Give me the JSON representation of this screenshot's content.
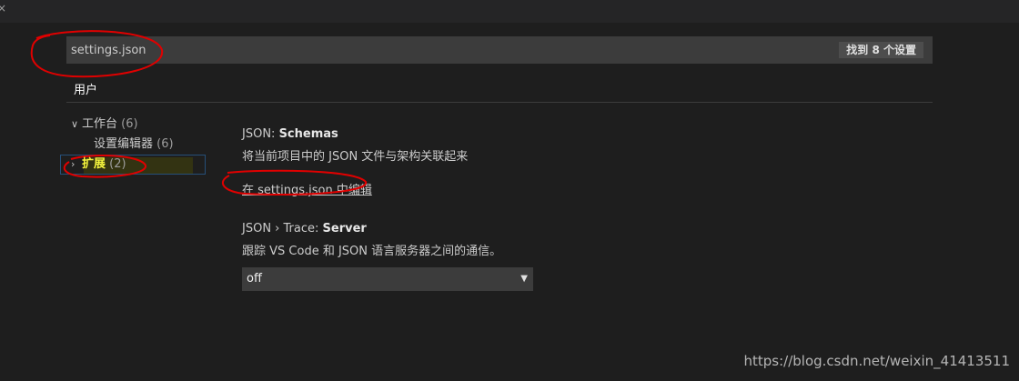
{
  "topbar": {
    "close_glyph": "×"
  },
  "search": {
    "value": "settings.json",
    "result_count": "找到 8 个设置"
  },
  "tabs": [
    {
      "label": "用户"
    }
  ],
  "tree": {
    "items": [
      {
        "label": "工作台",
        "count": "(6)",
        "expanded": true
      },
      {
        "label": "设置编辑器",
        "count": "(6)"
      },
      {
        "label": "扩展",
        "count": "(2)",
        "expanded": false,
        "selected": true
      }
    ]
  },
  "settings": [
    {
      "title_prefix": "JSON: ",
      "title_name": "Schemas",
      "description": "将当前项目中的 JSON 文件与架构关联起来",
      "link": "在 settings.json 中编辑"
    },
    {
      "title_prefix": "JSON › Trace: ",
      "title_name": "Server",
      "description": "跟踪 VS Code 和 JSON 语言服务器之间的通信。",
      "value": "off"
    }
  ],
  "icons": {
    "expanded": "chevron-down-icon",
    "collapsed": "chevron-right-icon",
    "dropdown": "dropdown-arrow-icon"
  },
  "annotation_color": "#e00000",
  "watermark": "https://blog.csdn.net/weixin_41413511"
}
